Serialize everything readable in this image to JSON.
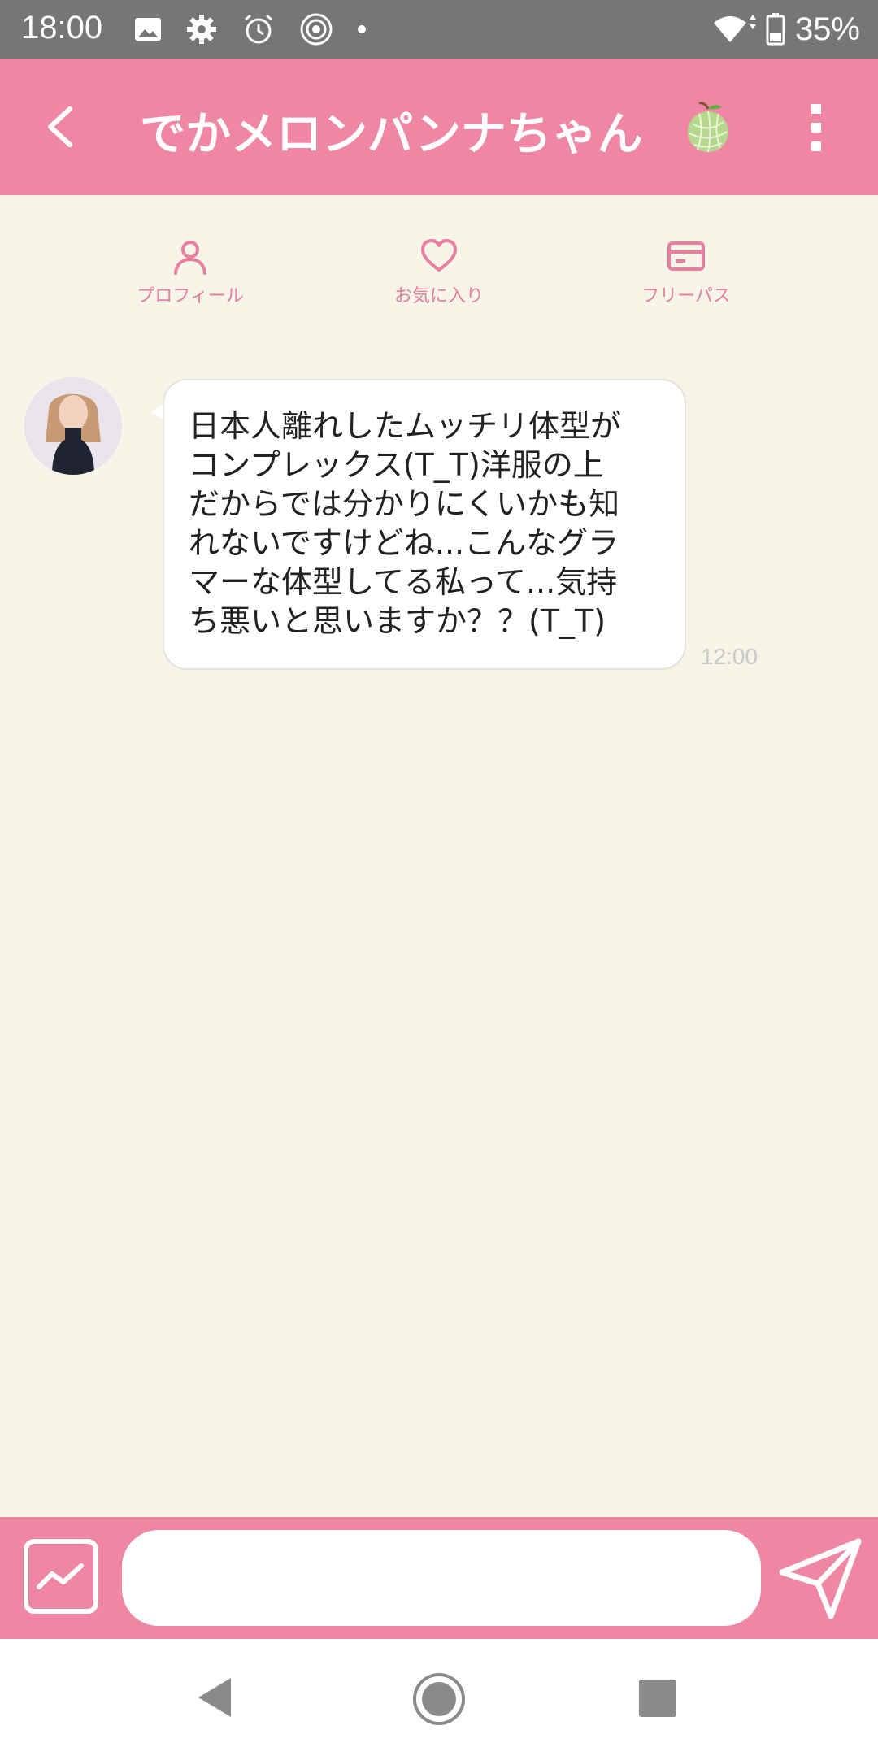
{
  "status_bar": {
    "time": "18:00",
    "battery": "35%",
    "icons": [
      "image-icon",
      "gear-icon",
      "alarm-icon",
      "target-icon",
      "dot-icon",
      "wifi-icon",
      "battery-icon"
    ]
  },
  "header": {
    "title": "でかメロンパンナちゃん",
    "title_icon": "melon-icon",
    "background": "#ee86a4"
  },
  "tabs": [
    {
      "label": "プロフィール",
      "icon": "person-icon"
    },
    {
      "label": "お気に入り",
      "icon": "heart-icon"
    },
    {
      "label": "フリーパス",
      "icon": "card-icon"
    }
  ],
  "messages": [
    {
      "text": "日本人離れしたムッチリ体型が\nコンプレックス(T_T)洋服の上\nだからでは分かりにくいかも知\nれないですけどね...こんなグラ\nマーな体型してる私って...気持\nち悪いと思いますか？？(T_T)",
      "time": "12:00"
    }
  ],
  "input": {
    "value": "",
    "placeholder": ""
  },
  "colors": {
    "accent": "#ee86a4",
    "background": "#f7f4e8",
    "tab_icon": "#ea7ea0"
  }
}
